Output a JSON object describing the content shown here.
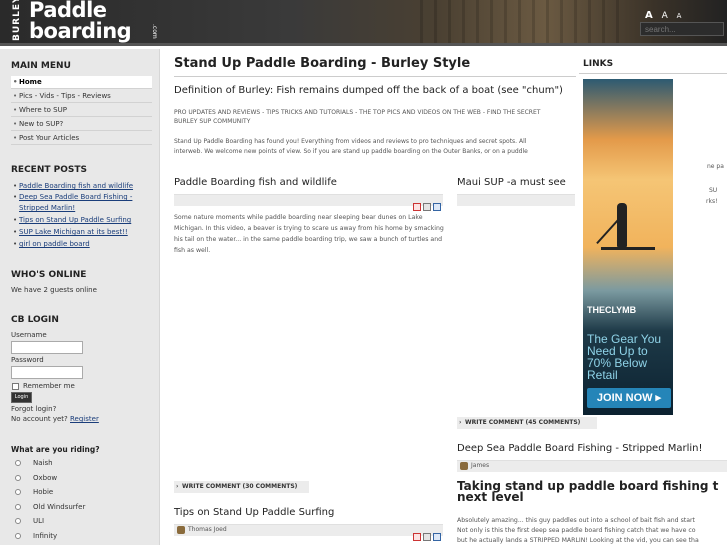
{
  "header": {
    "logo_burley": "BURLEY",
    "logo_line1": "Paddle",
    "logo_line2": "boarding",
    "logo_tld": ".com",
    "font_tools": [
      "A",
      "A",
      "A"
    ],
    "search_placeholder": "search..."
  },
  "sidebar": {
    "main_menu_title": "MAIN MENU",
    "menu": [
      {
        "label": "Home",
        "active": true
      },
      {
        "label": "Pics - Vids - Tips - Reviews"
      },
      {
        "label": "Where to SUP"
      },
      {
        "label": "New to SUP?"
      },
      {
        "label": "Post Your Articles"
      }
    ],
    "recent_posts_title": "RECENT POSTS",
    "recent_posts": [
      "Paddle Boarding fish and wildlife",
      "Deep Sea Paddle Board Fishing - Stripped Marlin!",
      "Tips on Stand Up Paddle Surfing",
      "SUP Lake Michigan at its best!!",
      "girl on paddle board"
    ],
    "whos_online_title": "WHO'S ONLINE",
    "whos_online_text": "We have 2 guests online",
    "cb_login_title": "CB LOGIN",
    "username_label": "Username",
    "password_label": "Password",
    "remember_label": "Remember me",
    "login_button": "Login",
    "forgot_login": "Forgot login?",
    "no_account": "No account yet?",
    "register": "Register",
    "poll_title": "What are you riding?",
    "poll_options": [
      "Naish",
      "Oxbow",
      "Hobie",
      "Old Windsurfer",
      "ULI",
      "Infinity"
    ]
  },
  "main": {
    "title": "Stand Up Paddle Boarding - Burley Style",
    "definition_heading": "Definition of Burley: Fish remains dumped off the back of a boat (see \"chum\")",
    "pro_updates": "PRO UPDATES AND REVIEWS - TIPS TRICKS AND TUTORIALS - THE TOP PICS AND VIDEOS ON THE WEB - FIND THE SECRET",
    "pro_updates_cont": "BURLEY SUP COMMUNITY",
    "intro_line1": "Stand Up Paddle Boarding has found you! Everything from videos and reviews to pro techniques and secret spots. All",
    "intro_line2": "interweb. We welcome new points of view. So if you are stand up paddle boarding on the Outer Banks, or on a puddle",
    "article_fish_title": "Paddle Boarding fish and wildlife",
    "article_fish_text": "Some nature moments while paddle boarding near sleeping bear dunes on Lake Michigan. In this video, a beaver is trying to scare us away from his home by smacking his tail on the water... in the same paddle boarding trip, we saw a bunch of turtles and fish as well.",
    "article_fish_comments": "WRITE COMMENT (30 COMMENTS)",
    "article_tips_title": "Tips on Stand Up Paddle Surfing",
    "article_tips_author": "Thomas Joed",
    "article_maui_title": "Maui SUP -a must see",
    "article_maui_comments": "WRITE COMMENT (45 COMMENTS)",
    "article_deepsea_title": "Deep Sea Paddle Board Fishing - Stripped Marlin!",
    "article_deepsea_author": "James",
    "article_deepsea_subtitle": "Taking stand up paddle board fishing t next level",
    "article_deepsea_text": [
      "Absolutely amazing... this guy paddles out into a school of bait fish and start",
      "Not only is this the first deep sea paddle board fishing catch that we have co",
      "but he actually lands a STRIPPED MARLIN! Looking at the vid, you can see tha"
    ],
    "overflow_fragments": [
      "ne pa",
      "SU",
      "rks!"
    ]
  },
  "links": {
    "title": "LINKS",
    "ad": {
      "brand": "THECLYMB",
      "slogan": "The Gear You Need Up to 70% Below Retail",
      "cta": "JOIN NOW ▸"
    }
  },
  "colors": {
    "link": "#1a3d7a",
    "sidebar_bg": "#e8e8e8",
    "header_bg": "#2a2a2a",
    "ad_cta": "#2585b8"
  }
}
